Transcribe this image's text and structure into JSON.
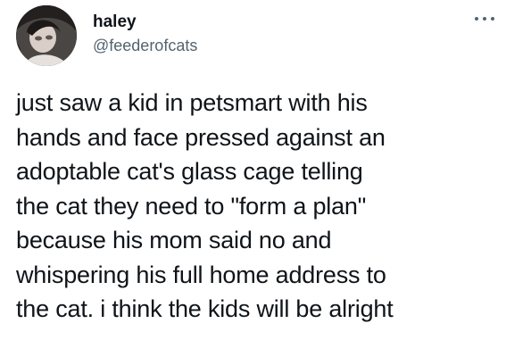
{
  "tweet": {
    "display_name": "haley",
    "handle": "@feederofcats",
    "more_icon": "more-options-icon",
    "body_lines": [
      "just saw a kid in petsmart with his",
      "hands and face pressed against an",
      "adoptable cat's glass cage telling",
      "the cat they need to \"form a plan\"",
      "because his mom said no and",
      "whispering his full home address to",
      "the cat. i think the kids will be alright"
    ]
  }
}
